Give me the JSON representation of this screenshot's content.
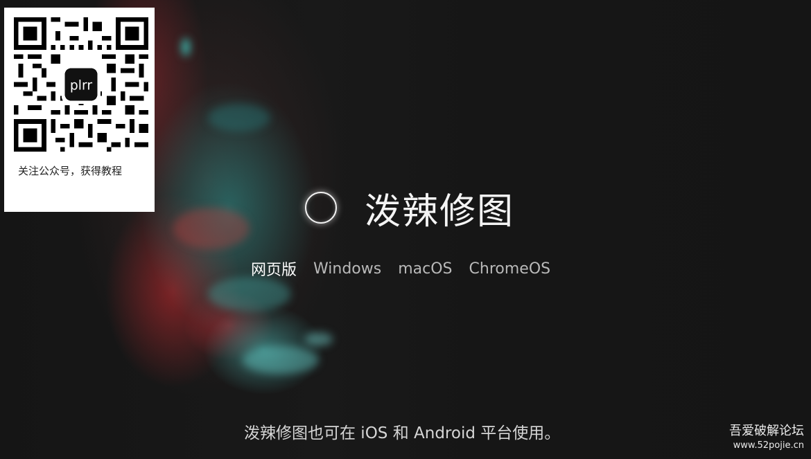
{
  "qr_card": {
    "logo_text": "plrr",
    "caption": "关注公众号，获得教程"
  },
  "hero": {
    "title": "泼辣修图",
    "icon": "ring-logo-icon"
  },
  "platforms": {
    "items": [
      "网页版",
      "Windows",
      "macOS",
      "ChromeOS"
    ],
    "active": "网页版"
  },
  "mobile_note": "泼辣修图也可在 iOS 和 Android 平台使用。",
  "watermark": {
    "name": "吾爱破解论坛",
    "url": "www.52pojie.cn"
  },
  "colors": {
    "background": "#141414",
    "teal_glitch": "#2a9690",
    "red_glitch": "#c82830"
  }
}
